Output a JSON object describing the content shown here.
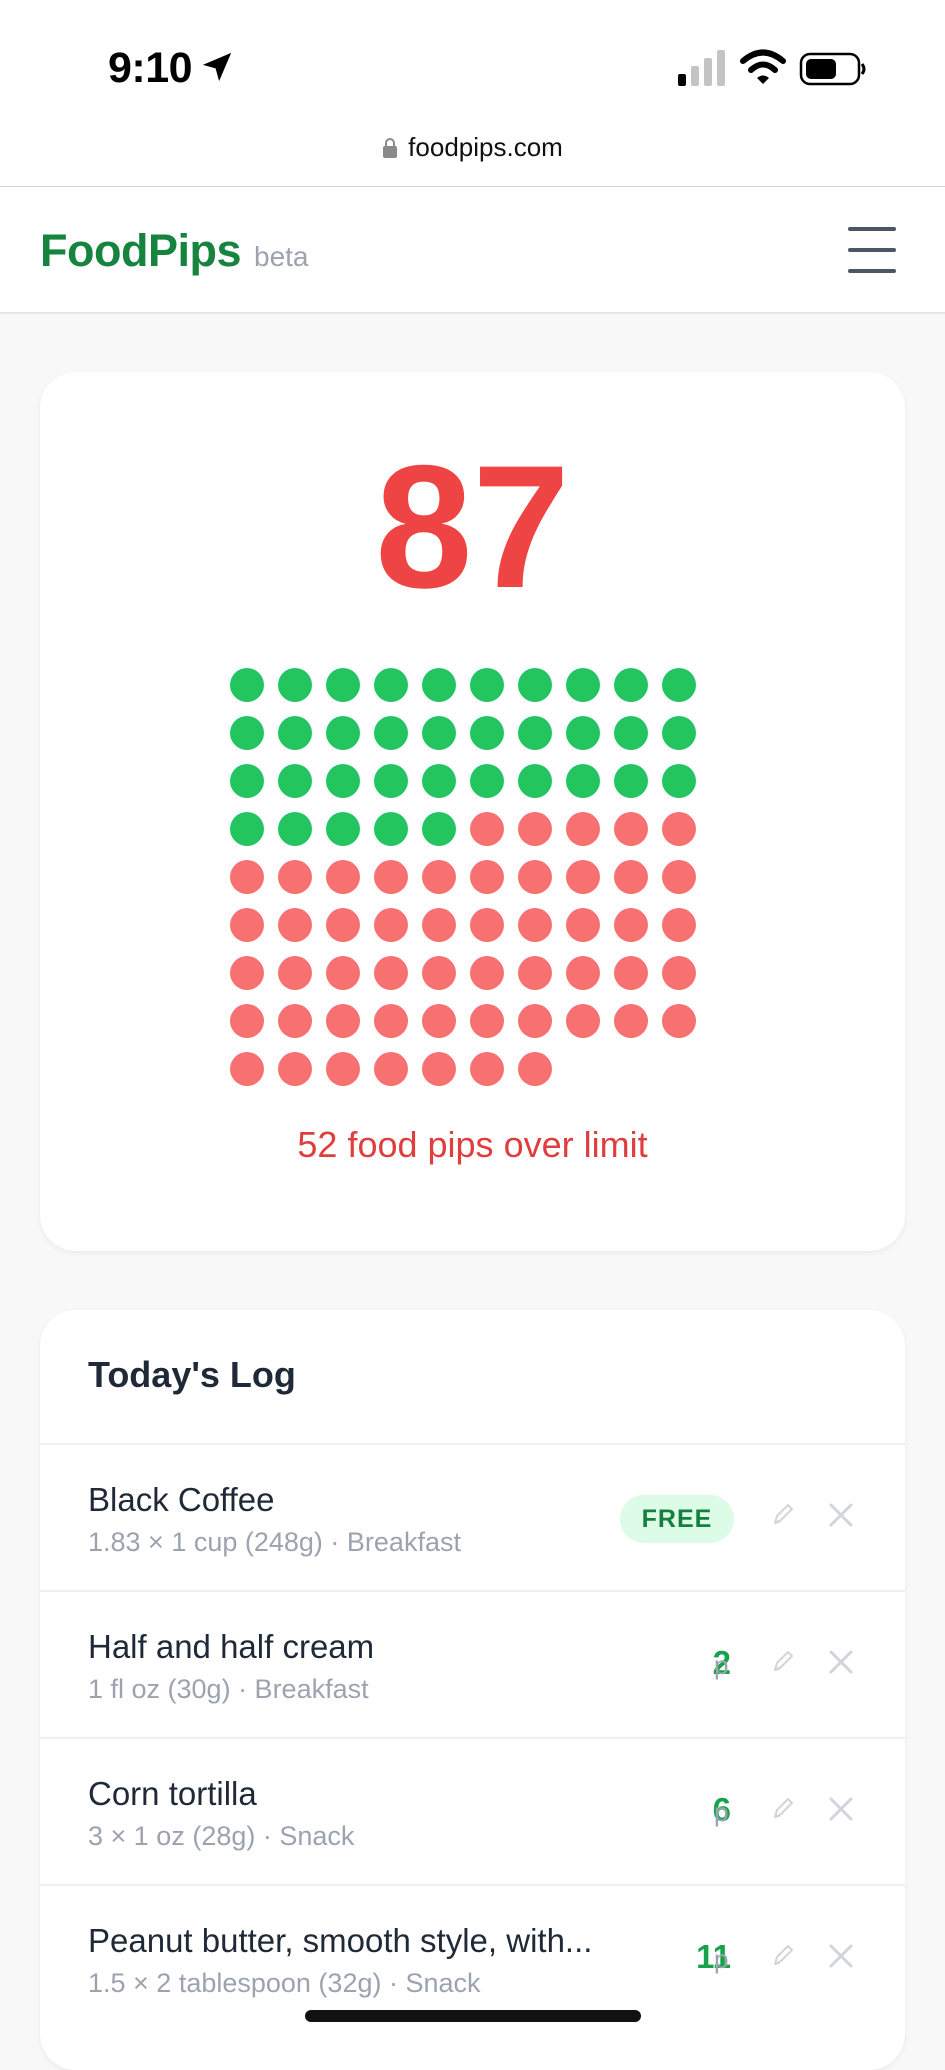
{
  "status_bar": {
    "time": "9:10"
  },
  "browser": {
    "url": "foodpips.com"
  },
  "header": {
    "brand": "FoodPips",
    "badge": "beta"
  },
  "score": {
    "value": "87",
    "pips_within_limit": 35,
    "pips_over_limit": 52,
    "over_label": "52 food pips over limit",
    "colors": {
      "within": "#22c55e",
      "over": "#f87171",
      "score": "#ef4444"
    }
  },
  "log": {
    "title": "Today's Log",
    "entries": [
      {
        "name": "Black Coffee",
        "detail": "1.83 × 1 cup (248g) · Breakfast",
        "badge": "FREE"
      },
      {
        "name": "Half and half cream",
        "detail": "1 fl oz (30g) · Breakfast",
        "pips": "2",
        "unit": "p"
      },
      {
        "name": "Corn tortilla",
        "detail": "3 × 1 oz (28g) · Snack",
        "pips": "6",
        "unit": "p"
      },
      {
        "name": "Peanut butter, smooth style, with...",
        "detail": "1.5 × 2 tablespoon (32g) · Snack",
        "pips": "11",
        "unit": "p"
      }
    ]
  }
}
